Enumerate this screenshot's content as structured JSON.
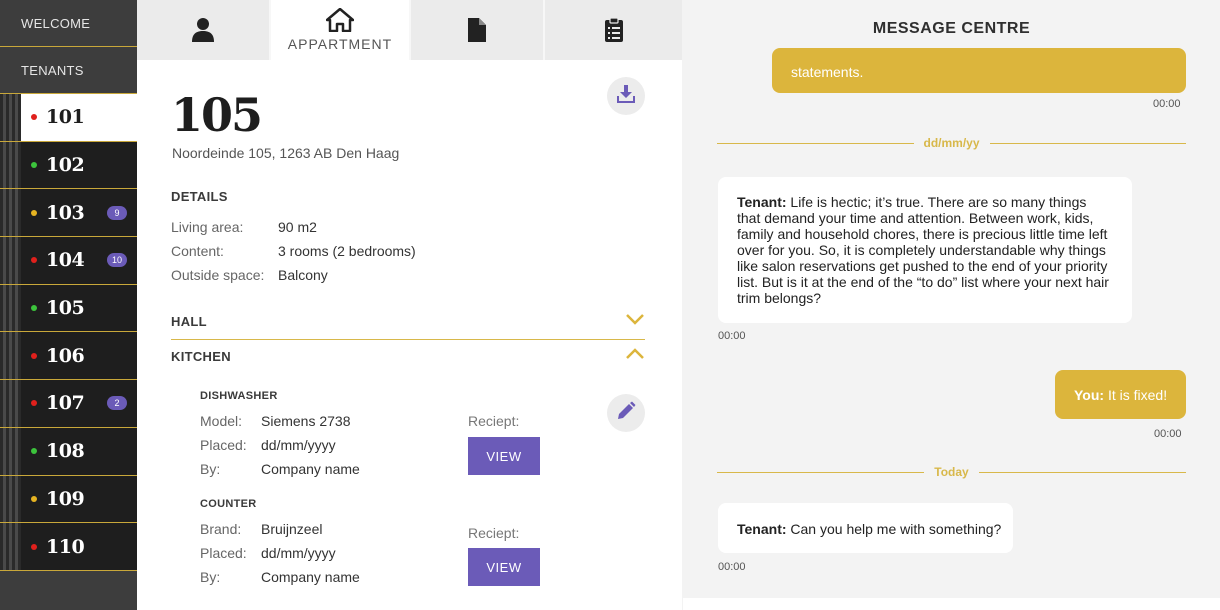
{
  "sidebar": {
    "welcome": "WELCOME",
    "tenants": "TENANTS",
    "units": [
      {
        "number": "101",
        "status_color": "#e0201c",
        "badge": "",
        "active": true
      },
      {
        "number": "102",
        "status_color": "#3cc43c",
        "badge": ""
      },
      {
        "number": "103",
        "status_color": "#e6b422",
        "badge": "9"
      },
      {
        "number": "104",
        "status_color": "#e0201c",
        "badge": "10"
      },
      {
        "number": "105",
        "status_color": "#3cc43c",
        "badge": ""
      },
      {
        "number": "106",
        "status_color": "#e0201c",
        "badge": ""
      },
      {
        "number": "107",
        "status_color": "#e0201c",
        "badge": "2"
      },
      {
        "number": "108",
        "status_color": "#3cc43c",
        "badge": ""
      },
      {
        "number": "109",
        "status_color": "#e6b422",
        "badge": ""
      },
      {
        "number": "110",
        "status_color": "#e0201c",
        "badge": ""
      }
    ]
  },
  "tabs": {
    "tenant": {
      "icon": "person-icon"
    },
    "appartment": {
      "label": "APPARTMENT",
      "icon": "home-icon"
    },
    "document": {
      "icon": "document-icon"
    },
    "clipboard": {
      "icon": "clipboard-icon"
    }
  },
  "unit": {
    "title": "105",
    "address": "Noordeinde 105, 1263 AB Den Haag"
  },
  "details": {
    "heading": "DETAILS",
    "rows": [
      {
        "label": "Living area:",
        "value": "90 m2"
      },
      {
        "label": "Content:",
        "value": "3 rooms (2 bedrooms)"
      },
      {
        "label": "Outside space:",
        "value": "Balcony"
      }
    ]
  },
  "sections": {
    "hall": "HALL",
    "kitchen": "KITCHEN"
  },
  "items": [
    {
      "title": "DISHWASHER",
      "rows": [
        {
          "label": "Model:",
          "value": "Siemens 2738"
        },
        {
          "label": "Placed:",
          "value": "dd/mm/yyyy"
        },
        {
          "label": "By:",
          "value": "Company name"
        }
      ],
      "reciept_label": "Reciept:",
      "view_label": "VIEW"
    },
    {
      "title": "COUNTER",
      "rows": [
        {
          "label": "Brand:",
          "value": "Bruijnzeel"
        },
        {
          "label": "Placed:",
          "value": "dd/mm/yyyy"
        },
        {
          "label": "By:",
          "value": "Company name"
        }
      ],
      "reciept_label": "Reciept:",
      "view_label": "VIEW"
    }
  ],
  "messages": {
    "header": "MESSAGE CENTRE",
    "first_bubble_text": "statements.",
    "first_time": "00:00",
    "date_sep_1": "dd/mm/yy",
    "msg2_sender": "Tenant:",
    "msg2_text": "Life is hectic; it’s true. There are so many things that demand your time and attention. Between work, kids, family and household chores, there is precious little time left over for you. So, it is completely understandable why things like salon reservations get pushed to the end of your priority list. But is it at the end of the “to do” list where your next hair trim belongs?",
    "msg2_time": "00:00",
    "msg3_sender": "You:",
    "msg3_text": "It is fixed!",
    "msg3_time": "00:00",
    "date_sep_2": "Today",
    "msg4_sender": "Tenant:",
    "msg4_text": "Can you help me with something?",
    "msg4_time": "00:00"
  },
  "colors": {
    "accent_gold": "#dcb53c",
    "accent_purple": "#6b5bb8",
    "sidebar_dark": "#1e1e1e"
  }
}
